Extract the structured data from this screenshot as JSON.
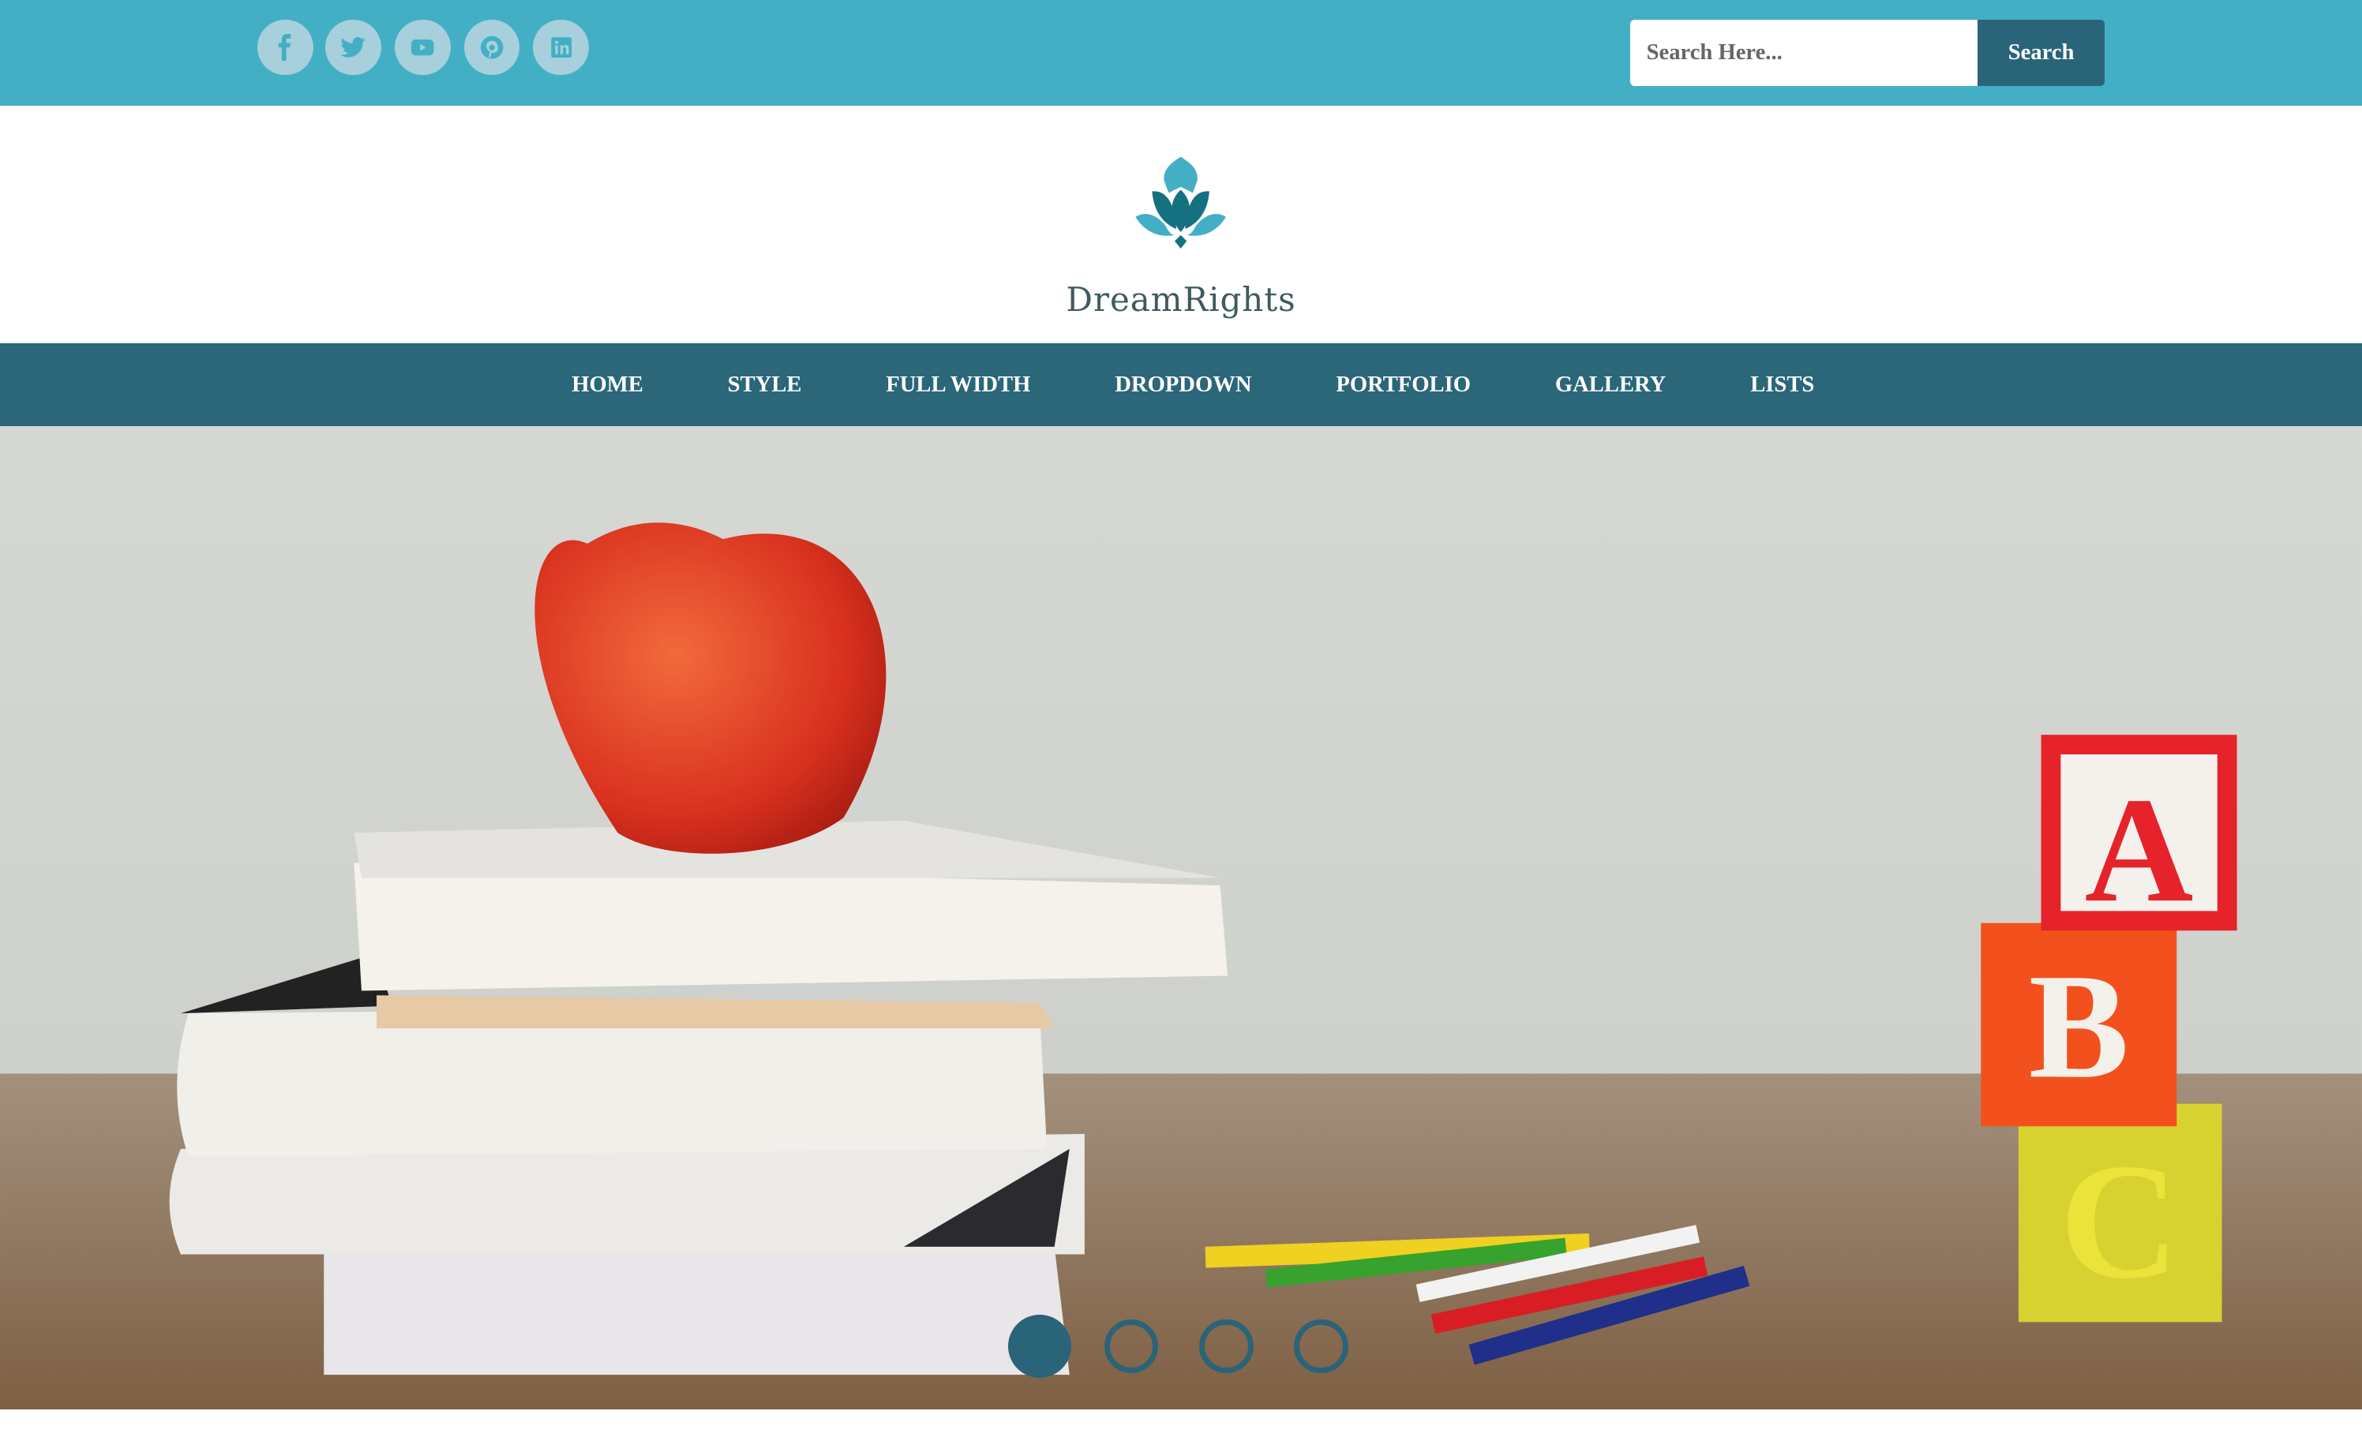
{
  "topbar": {
    "social": [
      {
        "icon": "facebook-icon",
        "label": "Facebook"
      },
      {
        "icon": "twitter-icon",
        "label": "Twitter"
      },
      {
        "icon": "youtube-icon",
        "label": "YouTube"
      },
      {
        "icon": "pinterest-icon",
        "label": "Pinterest"
      },
      {
        "icon": "linkedin-icon",
        "label": "LinkedIn"
      }
    ],
    "search_placeholder": "Search Here...",
    "search_button": "Search"
  },
  "header": {
    "logo_text": "DreamRights"
  },
  "nav": {
    "items": [
      "HOME",
      "STYLE",
      "FULL WIDTH",
      "DROPDOWN",
      "PORTFOLIO",
      "GALLERY",
      "LISTS"
    ]
  },
  "slider": {
    "slide_count": 4,
    "active_slide": 1
  },
  "colors": {
    "topbar": "#43afc4",
    "nav": "#2b6679",
    "accent": "#2a6478"
  }
}
